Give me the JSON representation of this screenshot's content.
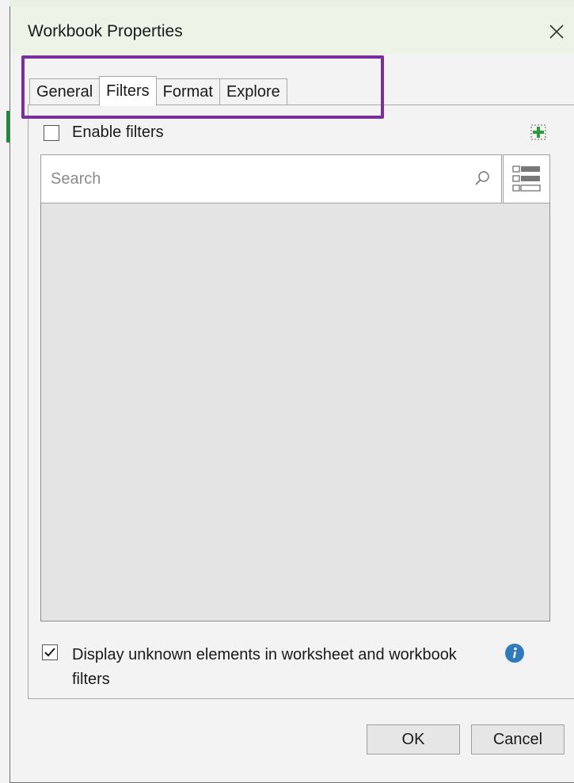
{
  "dialog": {
    "title": "Workbook Properties",
    "close_icon": "close-icon"
  },
  "tabs": [
    {
      "label": "General",
      "active": false
    },
    {
      "label": "Filters",
      "active": true
    },
    {
      "label": "Format",
      "active": false
    },
    {
      "label": "Explore",
      "active": false
    }
  ],
  "filters": {
    "enable_label": "Enable filters",
    "enable_checked": false,
    "add_icon": "add-filter-icon",
    "search_placeholder": "Search",
    "search_icon": "search-icon",
    "list_view_icon": "list-view-icon",
    "unknown_label": "Display unknown elements in worksheet and workbook filters",
    "unknown_checked": true,
    "info_icon": "info-icon"
  },
  "buttons": {
    "ok": "OK",
    "cancel": "Cancel"
  },
  "colors": {
    "highlight": "#7b2f9a",
    "add_icon_green": "#2e9a3e",
    "info_blue": "#2f7bbd"
  }
}
